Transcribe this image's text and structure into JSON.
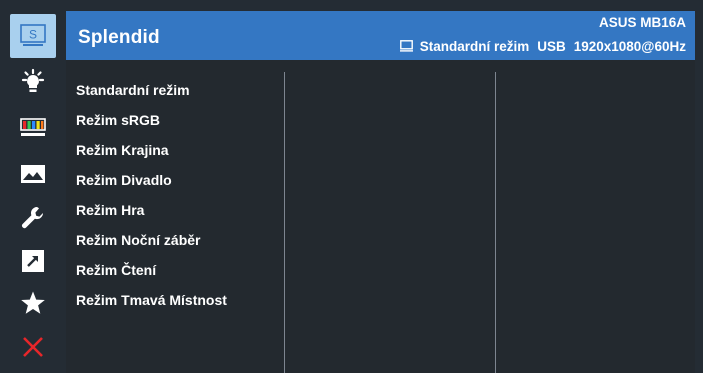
{
  "header": {
    "title": "Splendid",
    "model": "ASUS MB16A",
    "current_mode": "Standardní režim",
    "input": "USB",
    "resolution": "1920x1080@60Hz",
    "display_icon": "monitor-icon"
  },
  "sidebar": {
    "items": [
      {
        "icon": "splendid-icon",
        "active": true
      },
      {
        "icon": "brightness-icon"
      },
      {
        "icon": "color-icon"
      },
      {
        "icon": "image-icon"
      },
      {
        "icon": "system-setup-icon"
      },
      {
        "icon": "shortcut-icon"
      },
      {
        "icon": "favorite-star-icon"
      },
      {
        "icon": "close-icon"
      }
    ]
  },
  "menu": {
    "items": [
      "Standardní režim",
      "Režim sRGB",
      "Režim Krajina",
      "Režim Divadlo",
      "Režim Hra",
      "Režim Noční záběr",
      "Režim Čtení",
      "Režim Tmavá Místnost"
    ]
  },
  "colors": {
    "header_blue": "#3477c3",
    "active_tab": "#a9d0ee",
    "background": "#242c34",
    "close_red": "#e8262a",
    "text": "#ffffff"
  }
}
